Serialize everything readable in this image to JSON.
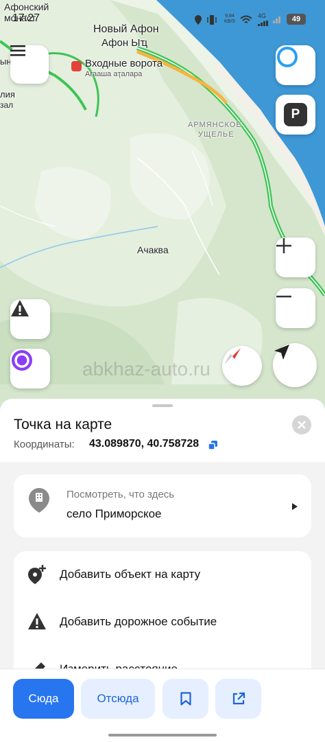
{
  "status_bar": {
    "time": "17:27",
    "net_speed": "9,84",
    "net_unit": "KB/S",
    "network": "4G",
    "battery": "49"
  },
  "map": {
    "labels": {
      "afonsky_1": "Афонский",
      "afonsky_2": "монаст",
      "novy_afon": "Новый Афон",
      "afon_abkh": "Афон Ыҵ",
      "gates": "Входные ворота",
      "gates_abkh": "Агааша аҭалара",
      "armenian_1": "АРМЯНСКОЕ",
      "armenian_2": "УЩЕЛЬЕ",
      "achkava": "Ачаква",
      "left_edge_1": "ын",
      "left_edge_2": "лия",
      "left_edge_3": "зал"
    },
    "watermark": "abkhaz-auto.ru",
    "road_color": "#3cc454",
    "sea_color": "#3e98d6"
  },
  "sheet": {
    "title": "Точка на карте",
    "coords_label": "Координаты:",
    "coords_value": "43.089870, 40.758728",
    "what_here_label": "Посмотреть, что здесь",
    "place_name": "село Приморское",
    "actions": [
      {
        "label": "Добавить объект на карту",
        "icon": "add-place-icon"
      },
      {
        "label": "Добавить дорожное событие",
        "icon": "road-event-icon"
      },
      {
        "label": "Измерить расстояние",
        "icon": "ruler-icon"
      }
    ]
  },
  "bottom_bar": {
    "here_label": "Сюда",
    "from_label": "Отсюда",
    "accent": "#2875f0"
  }
}
